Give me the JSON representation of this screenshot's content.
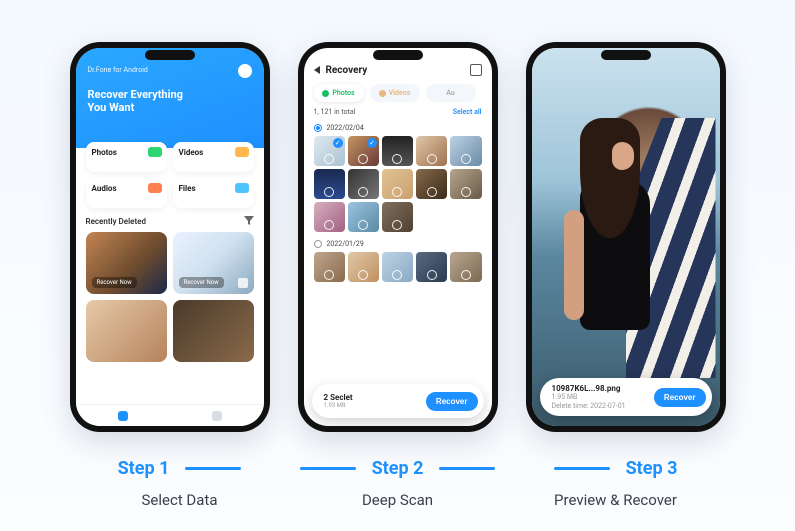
{
  "steps": {
    "s1": {
      "label": "Step 1",
      "caption": "Select Data"
    },
    "s2": {
      "label": "Step 2",
      "caption": "Deep Scan"
    },
    "s3": {
      "label": "Step 3",
      "caption": "Preview & Recover"
    }
  },
  "phone1": {
    "brand": "Dr.Fone for Android",
    "title_line1": "Recover Everything",
    "title_line2": "You Want",
    "tiles": {
      "photos": {
        "label": "Photos"
      },
      "videos": {
        "label": "Videos"
      },
      "audios": {
        "label": "Audios"
      },
      "files": {
        "label": "Files"
      }
    },
    "section_title": "Recently Deleted",
    "recover_now": "Recover Now"
  },
  "phone2": {
    "title": "Recovery",
    "tabs": {
      "photos": "Photos",
      "videos": "Videos",
      "audio": "Au"
    },
    "total": "1, 121 in total",
    "select_all": "Select all",
    "date1": "2022/02/04",
    "date2": "2022/01/29",
    "bar_title": "2 Seclet",
    "bar_sub": "1.93 MB",
    "recover": "Recover"
  },
  "phone3": {
    "bar_title": "10987K6L...98.png",
    "bar_sub1": "1.95 MB",
    "bar_sub2": "Delete time: 2022-07-01",
    "recover": "Recover"
  }
}
